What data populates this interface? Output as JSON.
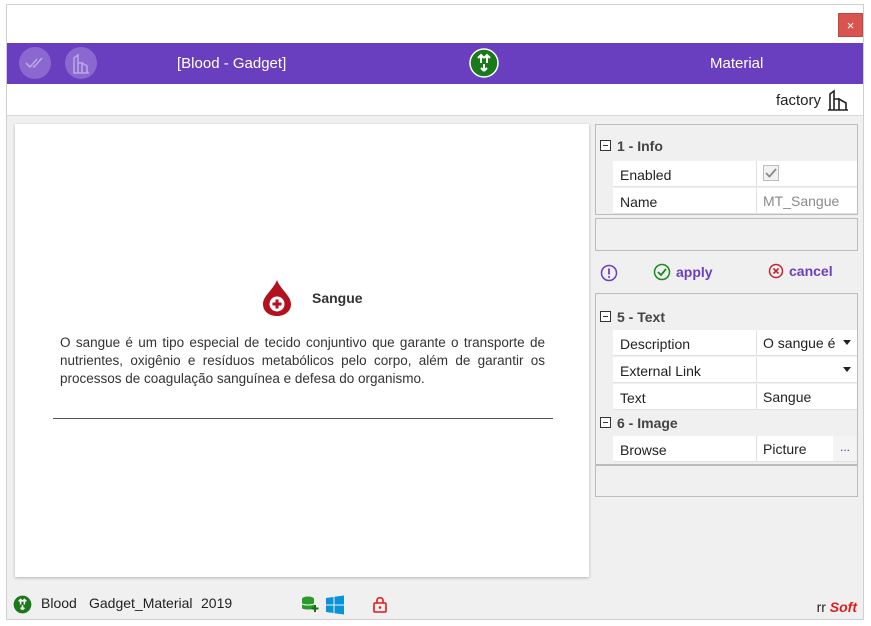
{
  "window": {
    "close_glyph": "×"
  },
  "header": {
    "title_left": "[Blood - Gadget]",
    "title_right": "Material",
    "bg_color": "#6a3fbf",
    "left_icons": [
      "double-check-icon",
      "factory-icon"
    ],
    "center_icon": "recycle-logo-icon"
  },
  "subbar": {
    "label": "factory",
    "icon": "factory-icon"
  },
  "preview": {
    "icon": "blood-drop-icon",
    "title": "Sangue",
    "description": "O sangue é um tipo especial de tecido conjuntivo que garante o transporte de nutrientes, oxigênio e resíduos metabólicos pelo corpo, além de garantir os processos de coagulação sanguínea e defesa do organismo."
  },
  "props_top": {
    "section": "1 - Info",
    "rows": [
      {
        "name": "Enabled",
        "value": "",
        "checked": true
      },
      {
        "name": "Name",
        "value": "MT_Sangue"
      }
    ]
  },
  "actions": {
    "apply_label": "apply",
    "cancel_label": "cancel",
    "accent_color": "#6a3fbf"
  },
  "props_bottom": {
    "section_text": "5 - Text",
    "text_rows": [
      {
        "name": "Description",
        "value": "O sangue é"
      },
      {
        "name": "External Link",
        "value": ""
      },
      {
        "name": "Text",
        "value": "Sangue"
      }
    ],
    "section_image": "6 - Image",
    "image_rows": [
      {
        "name": "Browse",
        "value": "Picture",
        "button": "..."
      }
    ]
  },
  "statusbar": {
    "app": "Blood",
    "module": "Gadget_Material",
    "year": "2019",
    "icons": [
      "database-add-icon",
      "windows-icon",
      "lock-icon"
    ],
    "brand_prefix": "rr",
    "brand_name": "Soft"
  }
}
